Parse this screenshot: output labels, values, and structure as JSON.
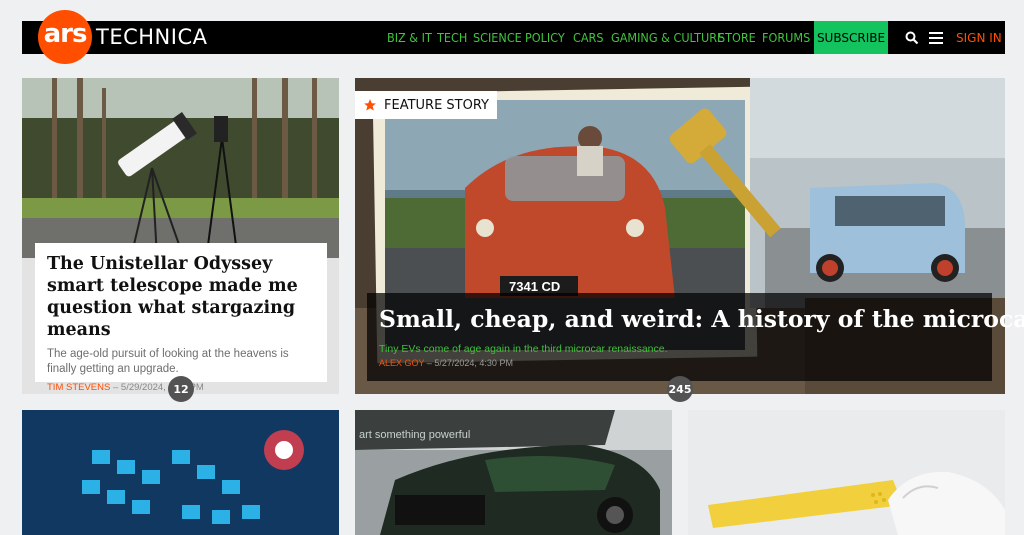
{
  "brand": {
    "logo_ars": "ars",
    "logo_technica": "TECHNICA",
    "accent": "#ff4e00",
    "nav_color": "#40c53d",
    "subscribe_bg": "#12c35e"
  },
  "nav": {
    "items": [
      "BIZ & IT",
      "TECH",
      "SCIENCE",
      "POLICY",
      "CARS",
      "GAMING & CULTURE",
      "STORE",
      "FORUMS"
    ],
    "subscribe_label": "SUBSCRIBE",
    "search_icon": "search-icon",
    "menu_icon": "hamburger-menu-icon",
    "signin_label": "SIGN IN"
  },
  "articles": {
    "left": {
      "title": "The Unistellar Odyssey smart telescope made me question what stargazing means",
      "dek": "The age-old pursuit of looking at the heavens is finally getting an upgrade.",
      "author": "TIM STEVENS",
      "date": "– 5/29/2024, 4:30 PM",
      "comments": "12"
    },
    "feature": {
      "label": "FEATURE STORY",
      "title": "Small, cheap, and weird: A history of the microcar",
      "dek": "Tiny EVs come of age again in the third microcar renaissance.",
      "author": "ALEX GOY",
      "date": "– 5/27/2024, 4:30 PM",
      "comments": "245",
      "plate": "7341 CD"
    },
    "bottom_middle": {
      "banner_text": "art something powerful"
    }
  }
}
